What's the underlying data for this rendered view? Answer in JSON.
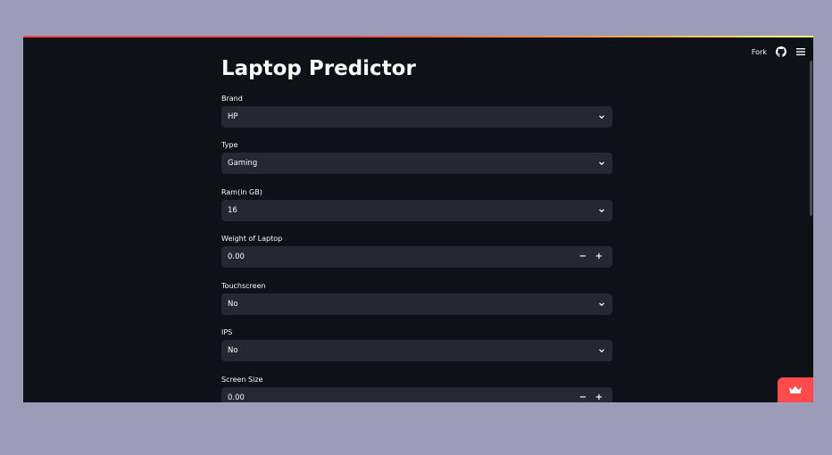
{
  "toolbar": {
    "fork_label": "Fork"
  },
  "page": {
    "title": "Laptop Predictor"
  },
  "fields": [
    {
      "label": "Brand",
      "value": "HP",
      "kind": "select"
    },
    {
      "label": "Type",
      "value": "Gaming",
      "kind": "select"
    },
    {
      "label": "Ram(in GB)",
      "value": "16",
      "kind": "select"
    },
    {
      "label": "Weight of Laptop",
      "value": "0.00",
      "kind": "number"
    },
    {
      "label": "Touchscreen",
      "value": "No",
      "kind": "select"
    },
    {
      "label": "IPS",
      "value": "No",
      "kind": "select"
    },
    {
      "label": "Screen Size",
      "value": "0.00",
      "kind": "number"
    }
  ],
  "colors": {
    "background": "#0e1117",
    "input": "#262730",
    "accent": "#ff4b4b",
    "text": "#fafafa"
  }
}
